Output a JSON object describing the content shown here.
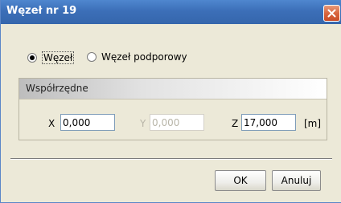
{
  "window": {
    "title": "Węzeł nr 19"
  },
  "node_type": {
    "options": [
      {
        "label": "Węzeł",
        "checked": true
      },
      {
        "label": "Węzeł podporowy",
        "checked": false
      }
    ]
  },
  "coordinates": {
    "title": "Współrzędne",
    "x": {
      "label": "X",
      "value": "0,000",
      "enabled": true
    },
    "y": {
      "label": "Y",
      "value": "0,000",
      "enabled": false
    },
    "z": {
      "label": "Z",
      "value": "17,000",
      "enabled": true
    },
    "unit": "[m]"
  },
  "buttons": {
    "ok": "OK",
    "cancel": "Anuluj"
  },
  "colors": {
    "titlebar": "#3c6fb8",
    "close": "#d9663f",
    "dialog_bg": "#ece9d8"
  },
  "icons": {
    "close": "close-icon"
  }
}
